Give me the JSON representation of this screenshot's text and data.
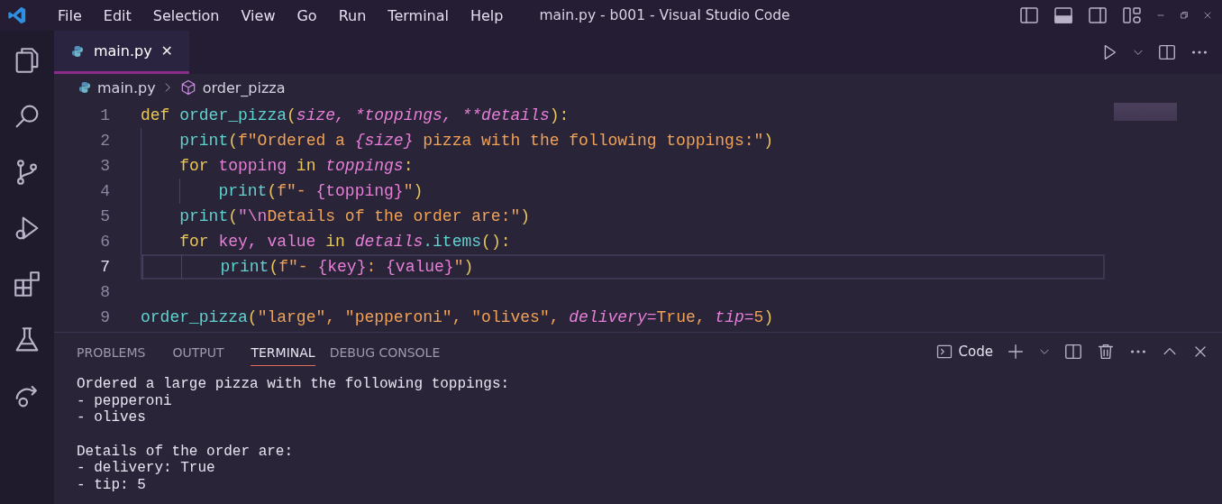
{
  "menu": [
    "File",
    "Edit",
    "Selection",
    "View",
    "Go",
    "Run",
    "Terminal",
    "Help"
  ],
  "window": {
    "title": "main.py - b001 - Visual Studio Code"
  },
  "tabs": [
    {
      "label": "main.py",
      "selected": true,
      "close": "✕"
    }
  ],
  "breadcrumb": [
    "main.py",
    "order_pizza"
  ],
  "code_lines": [
    {
      "number": "1",
      "current": false,
      "tokens": [
        {
          "text": "def ",
          "kind": "kw"
        },
        {
          "text": "order_pizza",
          "kind": "fn"
        },
        {
          "text": "(",
          "kind": "punct"
        },
        {
          "text": "size, ",
          "kind": "param"
        },
        {
          "text": "*toppings, ",
          "kind": "param"
        },
        {
          "text": "**details",
          "kind": "param"
        },
        {
          "text": "):",
          "kind": "punct"
        }
      ],
      "children": [
        {
          "number": "2",
          "current": false,
          "tokens": [
            {
              "text": "print",
              "kind": "fn"
            },
            {
              "text": "(",
              "kind": "punct"
            },
            {
              "text": "f\"Ordered a ",
              "kind": "str"
            },
            {
              "text": "{size}",
              "kind": "param"
            },
            {
              "text": " pizza with the following toppings:\"",
              "kind": "str"
            },
            {
              "text": ")",
              "kind": "punct"
            }
          ]
        },
        {
          "number": "3",
          "current": false,
          "tokens": [
            {
              "text": "for ",
              "kind": "kw"
            },
            {
              "text": "topping ",
              "kind": "var"
            },
            {
              "text": "in ",
              "kind": "kw"
            },
            {
              "text": "toppings",
              "kind": "param"
            },
            {
              "text": ":",
              "kind": "punct"
            }
          ],
          "children": [
            {
              "number": "4",
              "current": false,
              "tokens": [
                {
                  "text": "print",
                  "kind": "fn"
                },
                {
                  "text": "(",
                  "kind": "punct"
                },
                {
                  "text": "f\"- ",
                  "kind": "str"
                },
                {
                  "text": "{topping}",
                  "kind": "var"
                },
                {
                  "text": "\"",
                  "kind": "str"
                },
                {
                  "text": ")",
                  "kind": "punct"
                }
              ]
            }
          ]
        },
        {
          "number": "5",
          "current": false,
          "tokens": [
            {
              "text": "print",
              "kind": "fn"
            },
            {
              "text": "(",
              "kind": "punct"
            },
            {
              "text": "\"\\n",
              "kind": "var"
            },
            {
              "text": "Details of the order are:\"",
              "kind": "str"
            },
            {
              "text": ")",
              "kind": "punct"
            }
          ]
        },
        {
          "number": "6",
          "current": false,
          "tokens": [
            {
              "text": "for ",
              "kind": "kw"
            },
            {
              "text": "key, value ",
              "kind": "var"
            },
            {
              "text": "in ",
              "kind": "kw"
            },
            {
              "text": "details",
              "kind": "param"
            },
            {
              "text": ".items",
              "kind": "fn"
            },
            {
              "text": "():",
              "kind": "punct"
            }
          ],
          "children": [
            {
              "number": "7",
              "current": true,
              "tokens": [
                {
                  "text": "print",
                  "kind": "fn"
                },
                {
                  "text": "(",
                  "kind": "punct"
                },
                {
                  "text": "f\"- ",
                  "kind": "str"
                },
                {
                  "text": "{key}",
                  "kind": "var"
                },
                {
                  "text": ": ",
                  "kind": "str"
                },
                {
                  "text": "{value}",
                  "kind": "var"
                },
                {
                  "text": "\"",
                  "kind": "str"
                },
                {
                  "text": ")",
                  "kind": "punct"
                }
              ]
            }
          ]
        }
      ]
    },
    {
      "number": "8",
      "current": false
    },
    {
      "number": "9",
      "current": false,
      "tokens": [
        {
          "text": "order_pizza",
          "kind": "fn"
        },
        {
          "text": "(",
          "kind": "punct"
        },
        {
          "text": "\"large\", \"pepperoni\", \"olives\", ",
          "kind": "str"
        },
        {
          "text": "delivery",
          "kind": "param"
        },
        {
          "text": "=",
          "kind": "var"
        },
        {
          "text": "True",
          "kind": "str"
        },
        {
          "text": ", ",
          "kind": "str"
        },
        {
          "text": "tip",
          "kind": "param"
        },
        {
          "text": "=",
          "kind": "var"
        },
        {
          "text": "5",
          "kind": "str"
        },
        {
          "text": ")",
          "kind": "punct"
        }
      ]
    }
  ],
  "panel_tabs": [
    {
      "label": "PROBLEMS",
      "selected": false
    },
    {
      "label": "OUTPUT",
      "selected": false
    },
    {
      "label": "TERMINAL",
      "selected": true
    },
    {
      "label": "DEBUG CONSOLE",
      "selected": false
    }
  ],
  "terminal_profile": "Code",
  "terminal_output": [
    [
      "Ordered a large pizza with the following toppings:",
      "- pepperoni",
      "- olives"
    ],
    [
      "Details of the order are:",
      "- delivery: True",
      "- tip: 5"
    ]
  ]
}
